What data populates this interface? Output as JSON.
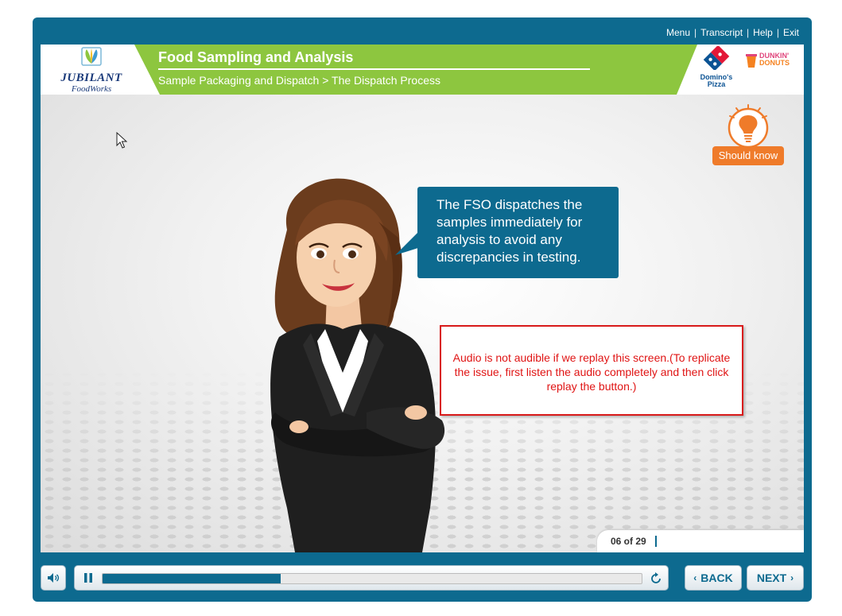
{
  "topnav": {
    "menu": "Menu",
    "transcript": "Transcript",
    "help": "Help",
    "exit": "Exit",
    "separator": "|"
  },
  "header": {
    "title": "Food Sampling and Analysis",
    "breadcrumb": "Sample Packaging and Dispatch > The Dispatch Process",
    "logo_left": {
      "name": "JUBILANT",
      "sub": "FoodWorks"
    },
    "logo_dominos": {
      "line1": "Domino's",
      "line2": "Pizza"
    },
    "logo_dunkin": {
      "line1": "DUNKIN'",
      "line2": "DONUTS"
    }
  },
  "stage": {
    "should_know": "Should know",
    "speech": "The FSO dispatches the samples immediately for analysis to avoid any discrepancies in testing.",
    "note": "Audio is not audible if we replay this screen.(To replicate the issue, first listen the audio completely and then click replay the button.)",
    "page_counter": "06 of 29"
  },
  "controls": {
    "back": "BACK",
    "next": "NEXT",
    "progress": 0.33,
    "icons": {
      "volume": "speaker-icon",
      "pause": "pause-icon",
      "replay": "replay-icon",
      "back": "chevron-left-icon",
      "next": "chevron-right-icon"
    }
  },
  "colors": {
    "frame": "#0d6a8f",
    "green": "#8dc63f",
    "orange": "#ef7b2a",
    "note_red": "#d81a1a"
  }
}
